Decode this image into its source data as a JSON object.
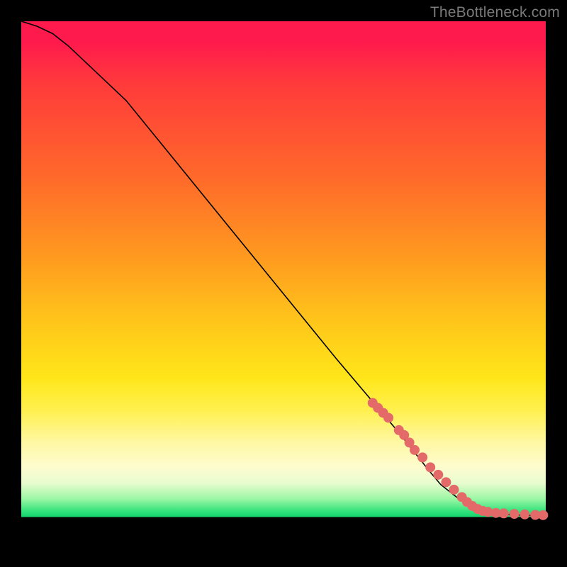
{
  "watermark": "TheBottleneck.com",
  "chart_data": {
    "type": "line",
    "title": "",
    "xlabel": "",
    "ylabel": "",
    "xlim": [
      0,
      100
    ],
    "ylim": [
      0,
      100
    ],
    "grid": false,
    "legend": false,
    "series": [
      {
        "name": "curve",
        "kind": "line",
        "color": "#000000",
        "x": [
          0,
          3,
          6,
          9,
          12,
          20,
          30,
          40,
          50,
          60,
          68,
          72,
          75,
          78,
          80,
          83,
          86,
          90,
          94,
          97,
          100
        ],
        "y": [
          100,
          99,
          97.5,
          95,
          92,
          84,
          71,
          58,
          45,
          32,
          22,
          17,
          13,
          9,
          6.5,
          4,
          2,
          0.7,
          0.4,
          0.3,
          0.3
        ]
      },
      {
        "name": "points",
        "kind": "scatter",
        "color": "#e46a6a",
        "x": [
          67,
          68,
          69,
          70,
          72,
          73,
          74,
          75,
          76.5,
          78,
          79.5,
          81,
          82.5,
          84,
          85,
          86,
          87,
          88,
          89,
          90.5,
          92,
          94,
          96,
          98,
          99.5
        ],
        "y": [
          23,
          22,
          21,
          20,
          17.5,
          16.5,
          15,
          13.5,
          12,
          10,
          8.5,
          7,
          5.5,
          4,
          3,
          2.2,
          1.6,
          1.2,
          1.0,
          0.8,
          0.7,
          0.6,
          0.5,
          0.4,
          0.35
        ]
      }
    ]
  }
}
